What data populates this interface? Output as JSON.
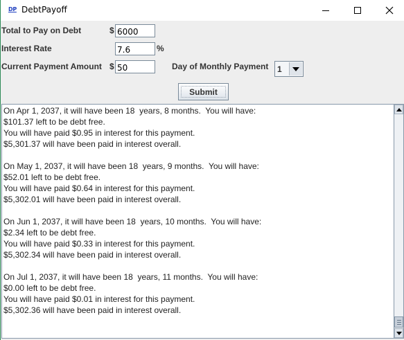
{
  "window": {
    "icon_text": "DP",
    "title": "DebtPayoff"
  },
  "form": {
    "total_label": "Total to Pay on Debt",
    "total_currency": "$",
    "total_value": "6000",
    "rate_label": "Interest Rate",
    "rate_value": "7.6",
    "rate_unit": "%",
    "payment_label": "Current Payment Amount",
    "payment_currency": "$",
    "payment_value": "50",
    "day_label": "Day of Monthly Payment",
    "day_value": "1",
    "submit_label": "Submit"
  },
  "output": {
    "lines": [
      "On Apr 1, 2037, it will have been 18  years, 8 months.  You will have:",
      "$101.37 left to be debt free.",
      "You will have paid $0.95 in interest for this payment.",
      "$5,301.37 will have been paid in interest overall.",
      "",
      "On May 1, 2037, it will have been 18  years, 9 months.  You will have:",
      "$52.01 left to be debt free.",
      "You will have paid $0.64 in interest for this payment.",
      "$5,302.01 will have been paid in interest overall.",
      "",
      "On Jun 1, 2037, it will have been 18  years, 10 months.  You will have:",
      "$2.34 left to be debt free.",
      "You will have paid $0.33 in interest for this payment.",
      "$5,302.34 will have been paid in interest overall.",
      "",
      "On Jul 1, 2037, it will have been 18  years, 11 months.  You will have:",
      "$0.00 left to be debt free.",
      "You will have paid $0.01 in interest for this payment.",
      "$5,302.36 will have been paid in interest overall."
    ]
  }
}
